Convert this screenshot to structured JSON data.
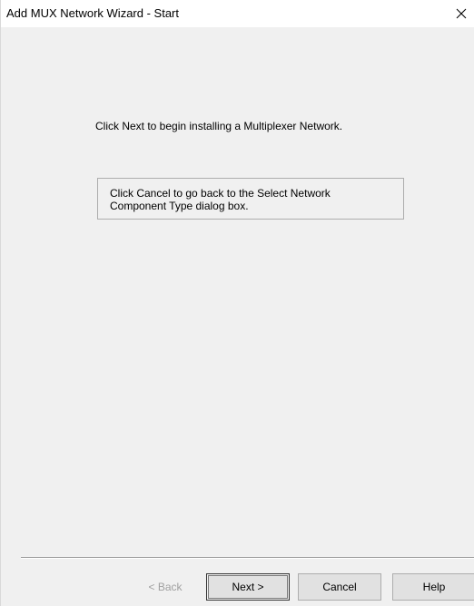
{
  "window": {
    "title": "Add MUX Network Wizard - Start"
  },
  "content": {
    "intro": "Click Next to begin installing a Multiplexer Network.",
    "info_line1": "Click Cancel to go back to the Select Network",
    "info_line2": "Component Type dialog box."
  },
  "buttons": {
    "back": "< Back",
    "next": "Next >",
    "cancel": "Cancel",
    "help": "Help"
  },
  "icons": {
    "close": "close-icon"
  },
  "colors": {
    "dialog_bg": "#f0f0f0",
    "titlebar_bg": "#ffffff",
    "disabled_text": "#a0a0a0"
  }
}
